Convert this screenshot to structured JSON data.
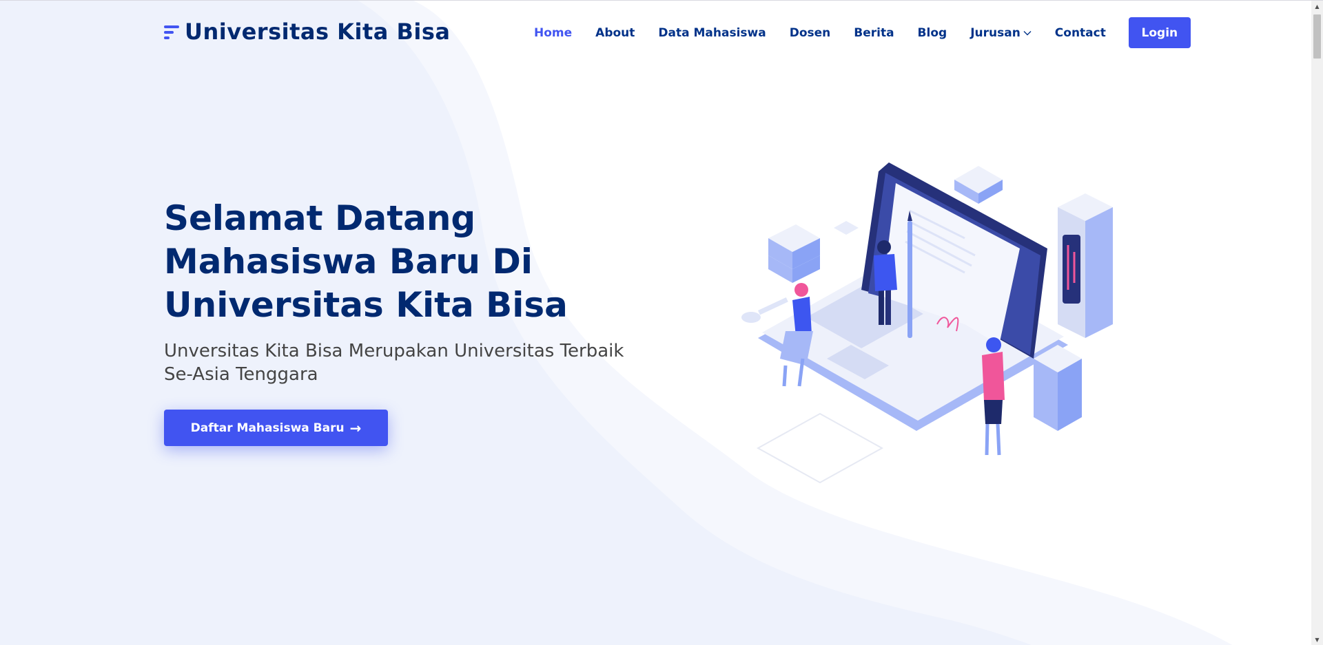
{
  "brand": {
    "name": "Universitas Kita Bisa"
  },
  "nav": {
    "items": [
      {
        "label": "Home",
        "active": true
      },
      {
        "label": "About"
      },
      {
        "label": "Data Mahasiswa"
      },
      {
        "label": "Dosen"
      },
      {
        "label": "Berita"
      },
      {
        "label": "Blog"
      },
      {
        "label": "Jurusan",
        "has_dropdown": true
      },
      {
        "label": "Contact"
      }
    ],
    "login_label": "Login"
  },
  "hero": {
    "title": "Selamat Datang Mahasiswa Baru Di Universitas Kita Bisa",
    "subtitle": "Unversitas Kita Bisa Merupakan Universitas Terbaik Se-Asia Tenggara",
    "cta_label": "Daftar Mahasiswa Baru",
    "cta_icon": "arrow-right-icon"
  },
  "colors": {
    "primary": "#4154f1",
    "heading": "#012970",
    "nav_text": "#013289",
    "background_wave": "#f0f3fc",
    "accent_pink": "#f0569a"
  }
}
